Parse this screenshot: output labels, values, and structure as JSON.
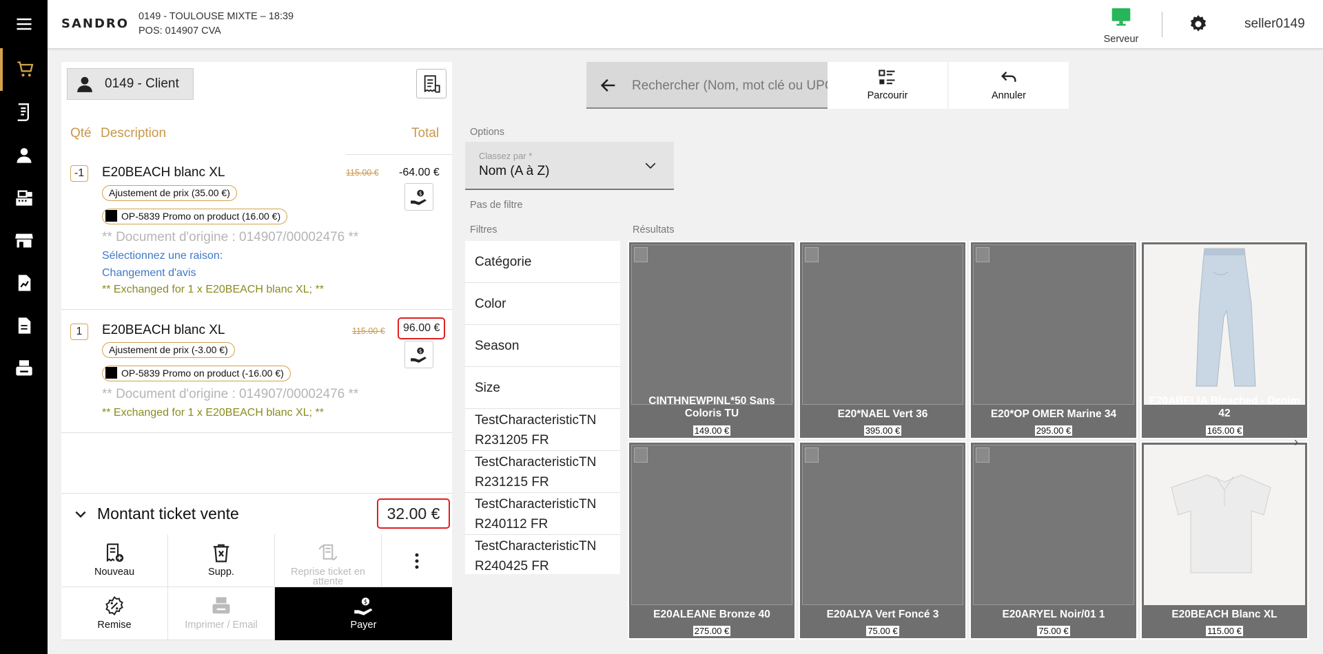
{
  "header": {
    "brand": "SANDRO",
    "store_line1": "0149 - TOULOUSE MIXTE – 18:39",
    "store_line2": "POS: 014907 CVA",
    "server_label": "Serveur",
    "user": "seller0149"
  },
  "ticket": {
    "client_label": "0149 - Client",
    "col_qty": "Qté",
    "col_desc": "Description",
    "col_total": "Total",
    "lines": [
      {
        "qty": "-1",
        "description": "E20BEACH blanc XL",
        "old_price": "115.00 €",
        "price": "-64.00 €",
        "adjust": "Ajustement de prix (35.00 €)",
        "promo": "OP-5839 Promo on product (16.00 €)",
        "origin": "** Document d'origine : 014907/00002476 **",
        "reason_prompt": "Sélectionnez une raison:",
        "reason": "Changement d'avis",
        "exchanged": "** Exchanged for 1 x E20BEACH blanc XL; **"
      },
      {
        "qty": "1",
        "description": "E20BEACH blanc XL",
        "old_price": "115.00 €",
        "price": "96.00 €",
        "adjust": "Ajustement de prix (-3.00 €)",
        "promo": "OP-5839 Promo on product (-16.00 €)",
        "origin": "** Document d'origine : 014907/00002476 **",
        "exchanged": "** Exchanged for 1 x E20BEACH blanc XL; **"
      }
    ],
    "summary_label": "Montant ticket vente",
    "summary_total": "32.00 €",
    "actions": {
      "new": "Nouveau",
      "delete": "Supp.",
      "resume": "Reprise ticket en attente",
      "discount": "Remise",
      "print": "Imprimer / Email",
      "pay": "Payer"
    }
  },
  "search": {
    "placeholder": "Rechercher (Nom, mot clé ou UPC)",
    "browse": "Parcourir",
    "cancel": "Annuler"
  },
  "options": {
    "label": "Options",
    "sort_label": "Classez par *",
    "sort_value": "Nom (A à Z)",
    "no_filter": "Pas de filtre",
    "filters_label": "Filtres",
    "results_label": "Résultats"
  },
  "filters": [
    "Catégorie",
    "Color",
    "Season",
    "Size",
    "TestCharacteristicTN R231205 FR",
    "TestCharacteristicTN R231215 FR",
    "TestCharacteristicTN R240112 FR",
    "TestCharacteristicTN R240425 FR"
  ],
  "products": [
    {
      "name": "CINTHNEWPINL*50 Sans Coloris TU",
      "price": "149.00 €"
    },
    {
      "name": "E20*NAEL Vert 36",
      "price": "395.00 €"
    },
    {
      "name": "E20*OP OMER Marine 34",
      "price": "295.00 €"
    },
    {
      "name": "E20ABELIA Bleached - Denim 42",
      "price": "165.00 €"
    },
    {
      "name": "E20ALEANE Bronze 40",
      "price": "275.00 €"
    },
    {
      "name": "E20ALYA Vert Foncé 3",
      "price": "75.00 €"
    },
    {
      "name": "E20ARYEL Noir/01 1",
      "price": "75.00 €"
    },
    {
      "name": "E20BEACH Blanc XL",
      "price": "115.00 €"
    }
  ],
  "colors": {
    "accent": "#d2a24c",
    "server_green": "#27b55a",
    "highlight_red": "#e02020"
  }
}
